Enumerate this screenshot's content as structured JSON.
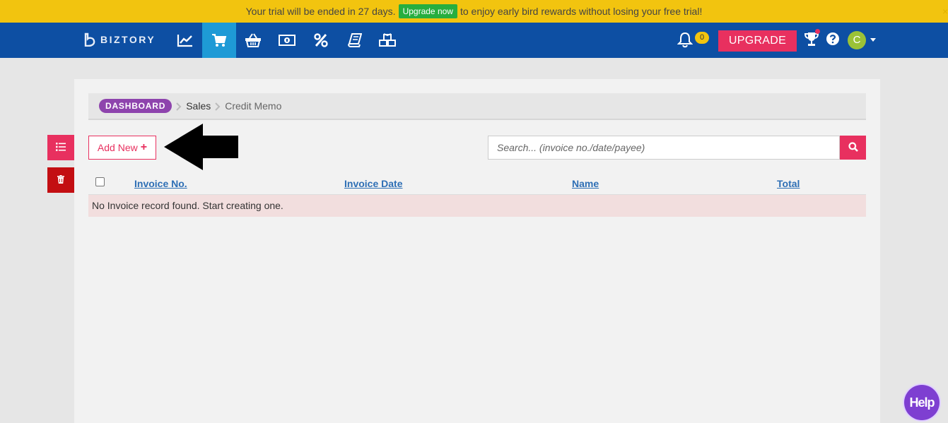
{
  "banner": {
    "prefix": "Your trial will be ended in 27 days.",
    "button_label": "Upgrade now",
    "suffix": "to enjoy early bird rewards without losing your free trial!",
    "close": "×"
  },
  "nav": {
    "logo_text": "BIZTORY",
    "icons": [
      "chart-line-icon",
      "shopping-cart-icon",
      "basket-icon",
      "money-icon",
      "percent-icon",
      "book-icon",
      "cubes-icon"
    ],
    "active_icon": "shopping-cart-icon",
    "notification_count": "0",
    "upgrade_label": "UPGRADE",
    "avatar_initial": "C"
  },
  "breadcrumb": {
    "dashboard": "DASHBOARD",
    "sales": "Sales",
    "current": "Credit Memo"
  },
  "toolbar": {
    "add_new_label": "Add New",
    "add_new_icon": "+",
    "search_placeholder": "Search... (invoice no./date/payee)"
  },
  "table": {
    "columns": [
      "Invoice No.",
      "Invoice Date",
      "Name",
      "Total"
    ],
    "empty_message": "No Invoice record found. Start creating one."
  },
  "help_button": "Help",
  "colors": {
    "banner": "#f2c40f",
    "nav": "#0d4fa3",
    "nav_active": "#1e9ad6",
    "accent": "#e8305f",
    "danger": "#c30e12",
    "badge": "#8e44ad",
    "link": "#2e6fb5",
    "empty_row": "#f2dede",
    "help": "#7e3fd1"
  }
}
